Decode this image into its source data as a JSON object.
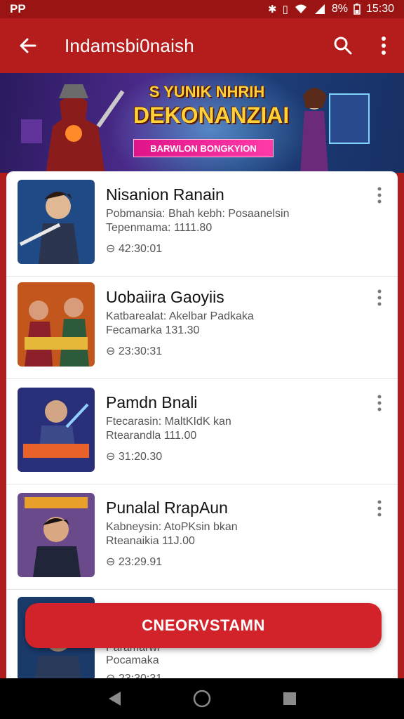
{
  "status_bar": {
    "left_label": "PP",
    "battery": "8%",
    "time": "15:30"
  },
  "app_bar": {
    "title": "Indamsbi0naish",
    "back_icon": "arrow-left-icon",
    "search_icon": "search-icon",
    "more_icon": "more-vertical-icon"
  },
  "banner": {
    "line1": "S YUNIK NHRIH",
    "line2": "DEKONANZIAI",
    "button_label": "BARWLON BONGKYION"
  },
  "items": [
    {
      "title": "Nisanion Ranain",
      "line1": "Pobmansia: Bhah kebh: Posaanelsin",
      "line2": "Tepenmama: 1111.80",
      "time": "⊖ 42:30:01"
    },
    {
      "title": "Uobaiira Gaoyiis",
      "line1": "Katbarealat: Akelbar Padkaka",
      "line2": "Fecamarka  131.30",
      "time": "⊖ 23:30:31"
    },
    {
      "title": "Pamdn Bnali",
      "line1": "Ftecarasin:  MaltKIdK kan",
      "line2": "Rtearandla  111.00",
      "time": "⊖ 31:20.30"
    },
    {
      "title": "Punalal RrapAun",
      "line1": "Kabneysin:  AtoPKsin bkan",
      "line2": "Rteanaikia  11J.00",
      "time": "⊖ 23:29.91"
    },
    {
      "title": "",
      "line1": "Paramarwi",
      "line2": "Pocamaka",
      "time": "⊖ 23:30:31"
    }
  ],
  "primary_button": "CNEORVSTAMN",
  "nav": {
    "back": "nav-back-icon",
    "home": "nav-home-icon",
    "recents": "nav-recents-icon"
  },
  "colors": {
    "primary": "#b51c1c",
    "status": "#9a1414",
    "button": "#d3232a"
  }
}
